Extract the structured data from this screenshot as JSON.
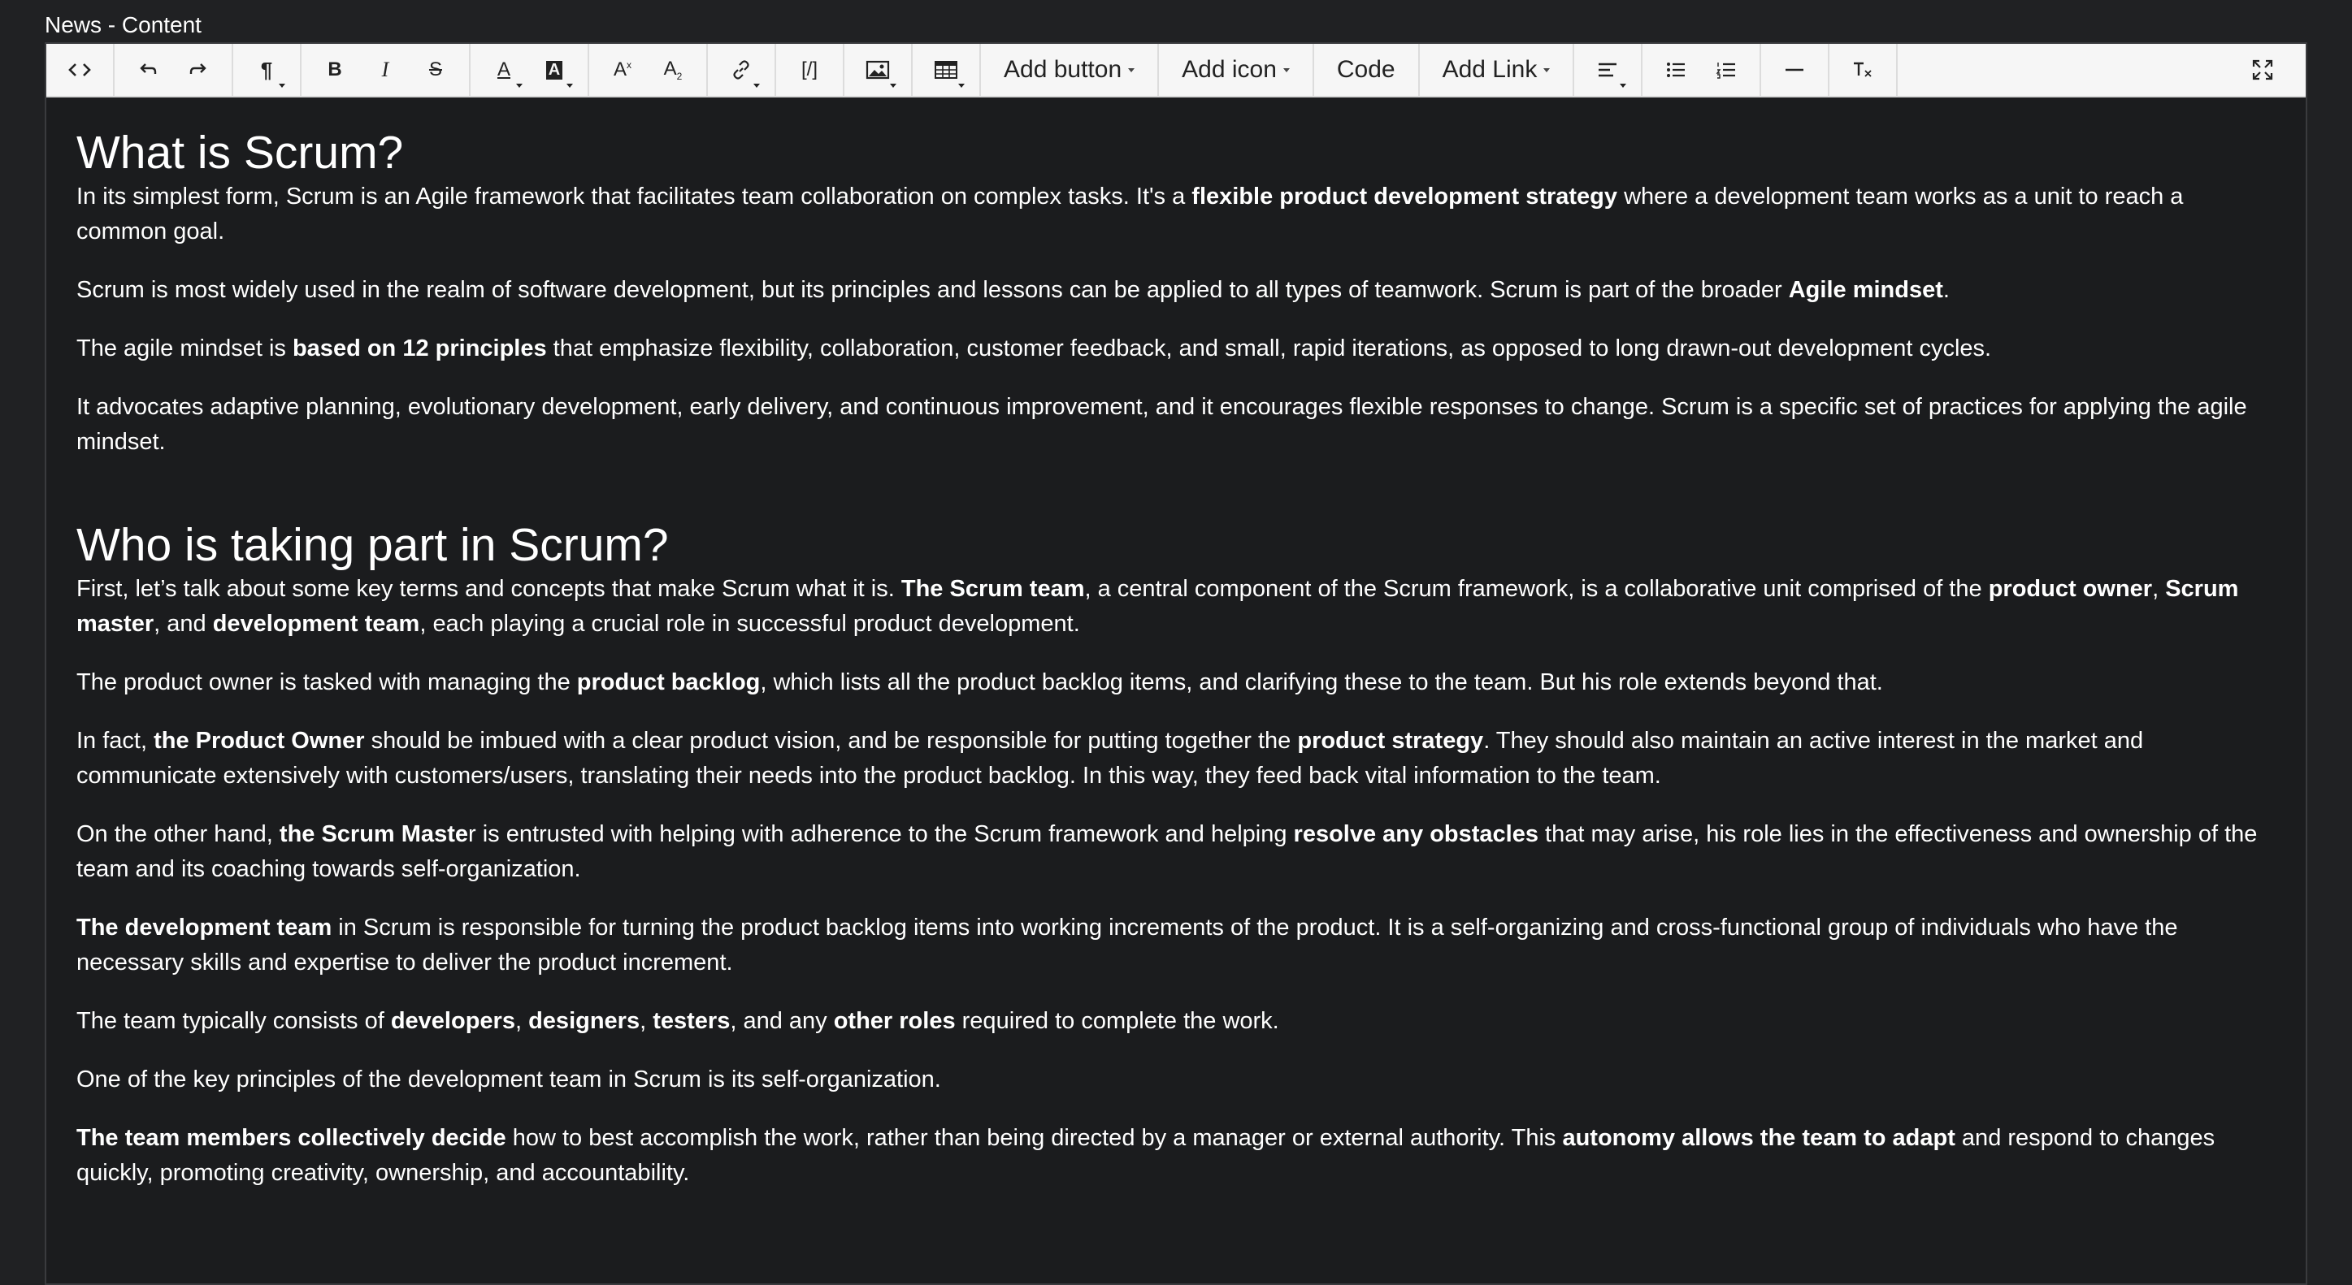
{
  "field": {
    "label": "News - Content"
  },
  "toolbar": {
    "add_button": "Add button",
    "add_icon": "Add icon",
    "code": "Code",
    "add_link": "Add Link",
    "code_view_glyph": "[/]",
    "bold_glyph": "B",
    "italic_glyph": "I",
    "strike_glyph": "S",
    "font_color_glyph": "A",
    "bg_color_glyph": "A",
    "superscript_glyph": "A",
    "subscript_glyph": "A",
    "paragraph_glyph": "¶"
  },
  "article": {
    "h1": "What is Scrum?",
    "p1": [
      "In its simplest form, Scrum is an Agile framework that facilitates team collaboration on complex tasks. It's a ",
      "flexible product development strategy",
      " where a development team works as a unit to reach a common goal."
    ],
    "p2": [
      "Scrum is most widely used in the realm of software development, but its principles and lessons can be applied to all types of teamwork. Scrum is part of the broader ",
      "Agile mindset",
      "."
    ],
    "p3": [
      "The agile mindset is ",
      "based on 12 principles",
      " that emphasize flexibility, collaboration, customer feedback, and small, rapid iterations, as opposed to long drawn-out development cycles."
    ],
    "p4": "It advocates adaptive planning, evolutionary development, early delivery, and continuous improvement, and it encourages flexible responses to change. Scrum is a specific set of practices for applying the agile mindset.",
    "h2": "Who is taking part in Scrum?",
    "p5": [
      "First, let’s talk about some key terms and concepts that make Scrum what it is. ",
      "The Scrum team",
      ", a central component of the Scrum framework, is a collaborative unit comprised of the ",
      "product owner",
      ", ",
      "Scrum master",
      ", and ",
      "development team",
      ", each playing a crucial role in successful product development."
    ],
    "p6": [
      "The product owner is tasked with managing the ",
      "product backlog",
      ", which lists all the product backlog items, and clarifying these to the team. But his role extends beyond that."
    ],
    "p7": [
      "In fact, ",
      "the Product Owner",
      " should be imbued with a clear product vision, and be responsible for putting together the ",
      "product strategy",
      ". They should also maintain an active interest in the market and communicate extensively with customers/users, translating their needs into the product backlog. In this way, they feed back vital information to the team."
    ],
    "p8": [
      "On the other hand, ",
      "the Scrum Maste",
      "r is entrusted with helping with adherence to the Scrum framework and helping ",
      "resolve any obstacles",
      " that may arise, his role lies in the effectiveness and ownership of the team and its coaching towards self-organization."
    ],
    "p9": [
      "The development team",
      " in Scrum is responsible for turning the product backlog items into working increments of the product. It is a self-organizing and cross-functional group of individuals who have the necessary skills and expertise to deliver the product increment."
    ],
    "p10": [
      "The team typically consists of ",
      "developers",
      ", ",
      "designers",
      ", ",
      "testers",
      ", and any ",
      "other roles",
      " required to complete the work."
    ],
    "p11": "One of the key principles of the development team in Scrum is its self-organization.",
    "p12": [
      "The team members collectively decide",
      " how to best accomplish the work, rather than being directed by a manager or external authority. This ",
      "autonomy allows the team to adapt",
      " and respond to changes quickly, promoting creativity, ownership, and accountability."
    ]
  }
}
